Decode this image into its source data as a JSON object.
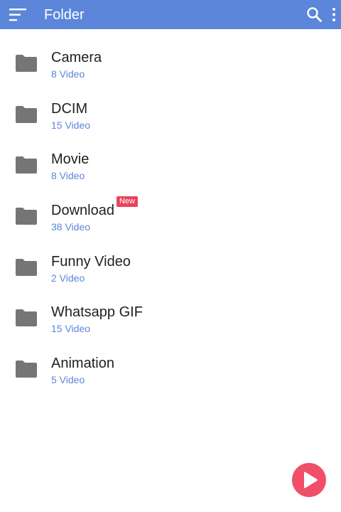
{
  "appbar": {
    "title": "Folder",
    "menu_icon": "menu-icon",
    "search_icon": "search-icon",
    "more_icon": "more-vert-icon",
    "color": "#5b86d9"
  },
  "folders": [
    {
      "name": "Camera",
      "count": "8 Video"
    },
    {
      "name": "DCIM",
      "count": "15 Video"
    },
    {
      "name": "Movie",
      "count": "8 Video"
    },
    {
      "name": "Download",
      "count": "38 Video",
      "badge": "New"
    },
    {
      "name": "Funny Video",
      "count": "2 Video"
    },
    {
      "name": "Whatsapp GIF",
      "count": "15 Video"
    },
    {
      "name": "Animation",
      "count": "5 Video"
    }
  ],
  "folder_icon": "folder-icon",
  "fab": {
    "icon": "play-icon",
    "color": "#f04f67"
  },
  "colors": {
    "accent": "#5b86d9",
    "badge": "#e8445c",
    "folder_icon": "#757575"
  }
}
